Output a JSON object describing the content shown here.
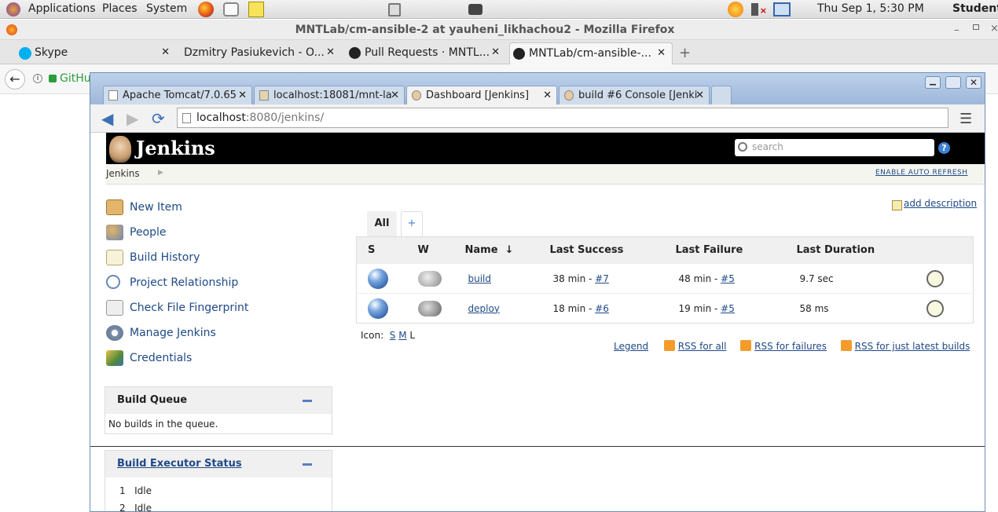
{
  "panel": {
    "applications": "Applications",
    "places": "Places",
    "system": "System",
    "clock": "Thu Sep  1,  5:30 PM",
    "user": "Student"
  },
  "firefox": {
    "title": "MNTLab/cm-ansible-2 at yauheni_likhachou2 - Mozilla Firefox",
    "tabs": [
      {
        "label": "Skype"
      },
      {
        "label": "Dzmitry Pasiukevich - O..."
      },
      {
        "label": "Pull Requests · MNTL..."
      },
      {
        "label": "MNTLab/cm-ansible-..."
      }
    ],
    "url_partial": "GitHu"
  },
  "inner": {
    "tabs": [
      {
        "label": "Apache Tomcat/7.0.65"
      },
      {
        "label": "localhost:18081/mnt-la"
      },
      {
        "label": "Dashboard [Jenkins]"
      },
      {
        "label": "build #6 Console [Jenki"
      }
    ],
    "url_host": "localhost",
    "url_rest": ":8080/jenkins/"
  },
  "jenkins": {
    "logo": "Jenkins",
    "search_placeholder": "search",
    "breadcrumb": "Jenkins",
    "auto_refresh": "ENABLE AUTO REFRESH",
    "sidebar": [
      {
        "label": "New Item",
        "icon": "new-item-icon"
      },
      {
        "label": "People",
        "icon": "people-icon"
      },
      {
        "label": "Build History",
        "icon": "build-history-icon"
      },
      {
        "label": "Project Relationship",
        "icon": "project-relationship-icon"
      },
      {
        "label": "Check File Fingerprint",
        "icon": "fingerprint-icon"
      },
      {
        "label": "Manage Jenkins",
        "icon": "gear-icon"
      },
      {
        "label": "Credentials",
        "icon": "credentials-icon"
      }
    ],
    "build_queue": {
      "title": "Build Queue",
      "empty": "No builds in the queue."
    },
    "executor": {
      "title": "Build Executor Status",
      "items": [
        {
          "num": "1",
          "status": "Idle"
        },
        {
          "num": "2",
          "status": "Idle"
        }
      ]
    },
    "add_description": "add description",
    "view_tabs": {
      "all": "All",
      "add": "+"
    },
    "columns": {
      "s": "S",
      "w": "W",
      "name": "Name",
      "sort": "↓",
      "last_success": "Last Success",
      "last_failure": "Last Failure",
      "last_duration": "Last Duration"
    },
    "jobs": [
      {
        "name": "build",
        "success_time": "38 min - ",
        "success_link": "#7",
        "failure_time": "48 min - ",
        "failure_link": "#5",
        "duration": "9.7 sec"
      },
      {
        "name": "deploy",
        "success_time": "18 min - ",
        "success_link": "#6",
        "failure_time": "19 min - ",
        "failure_link": "#5",
        "duration": "58 ms"
      }
    ],
    "icon_size": {
      "label": "Icon:",
      "s": "S",
      "m": "M",
      "l": "L"
    },
    "footer_links": {
      "legend": "Legend",
      "rss_all": "RSS for all",
      "rss_failures": "RSS for failures",
      "rss_latest": "RSS for just latest builds"
    }
  }
}
